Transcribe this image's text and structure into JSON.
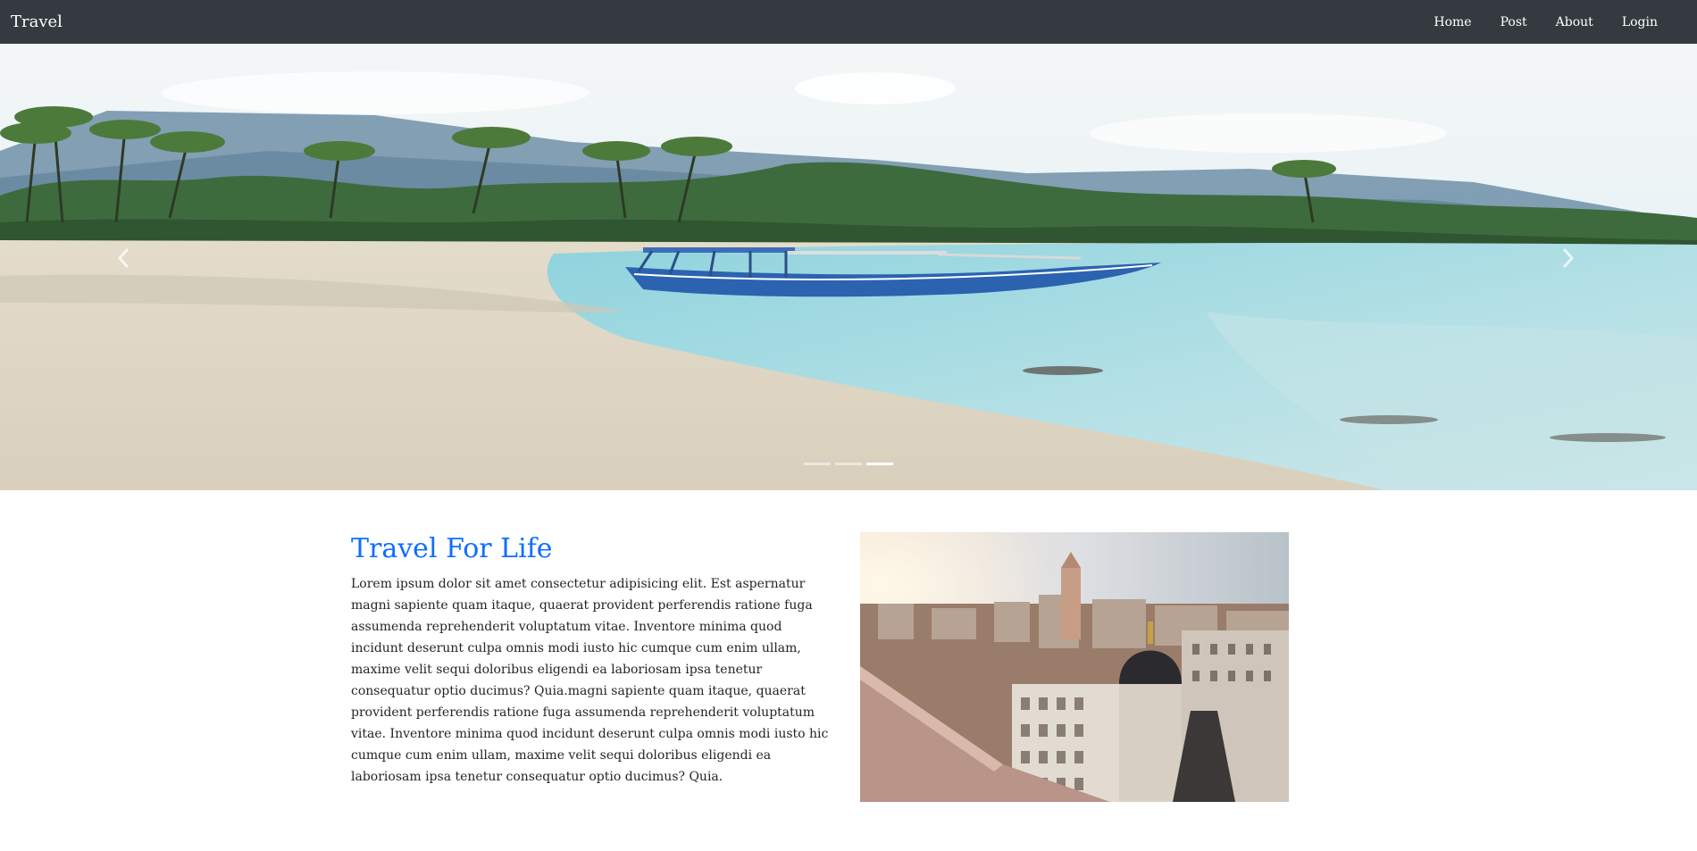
{
  "navbar": {
    "brand": "Travel",
    "links": [
      {
        "label": "Home"
      },
      {
        "label": "Post"
      },
      {
        "label": "About"
      },
      {
        "label": "Login"
      }
    ]
  },
  "carousel": {
    "slide_count": 3,
    "active_index": 2,
    "prev_icon": "chevron-left-icon",
    "next_icon": "chevron-right-icon"
  },
  "feature": {
    "title": "Travel For Life",
    "body": "Lorem ipsum dolor sit amet consectetur adipisicing elit. Est aspernatur magni sapiente quam itaque, quaerat provident perferendis ratione fuga assumenda reprehenderit voluptatum vitae. Inventore minima quod incidunt deserunt culpa omnis modi iusto hic cumque cum enim ullam, maxime velit sequi doloribus eligendi ea laboriosam ipsa tenetur consequatur optio ducimus? Quia.magni sapiente quam itaque, quaerat provident perferendis ratione fuga assumenda reprehenderit voluptatum vitae. Inventore minima quod incidunt deserunt culpa omnis modi iusto hic cumque cum enim ullam, maxime velit sequi doloribus eligendi ea laboriosam ipsa tenetur consequatur optio ducimus? Quia."
  },
  "colors": {
    "navbar_bg": "#343a40",
    "heading": "#0d6efd",
    "text": "#212529"
  }
}
